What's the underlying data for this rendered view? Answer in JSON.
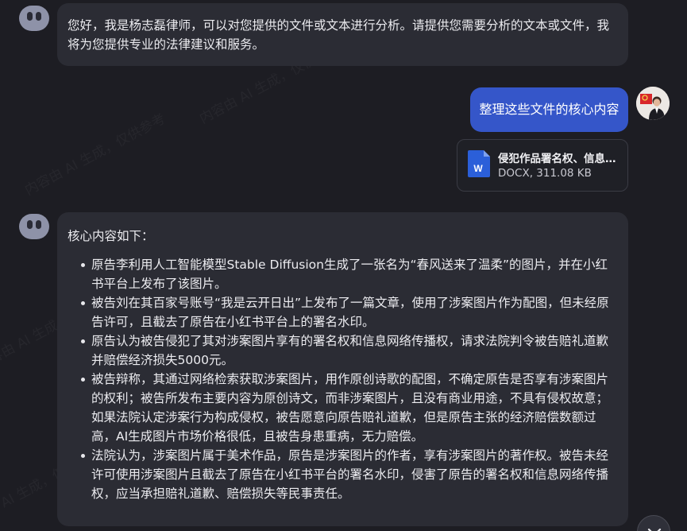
{
  "messages": {
    "greeting": "您好，我是杨志磊律师，可以对您提供的文件或文本进行分析。请提供您需要分析的文本或文件，我将为您提供专业的法律建议和服务。",
    "user_request": "整理这些文件的核心内容",
    "attachment": {
      "name": "侵犯作品署名权、信息…",
      "meta": "DOCX, 311.08 KB",
      "icon": "word-document-icon"
    },
    "answer": {
      "intro": "核心内容如下：",
      "points": [
        "原告李利用人工智能模型Stable Diffusion生成了一张名为“春风送来了温柔”的图片，并在小红书平台上发布了该图片。",
        "被告刘在其百家号账号“我是云开日出”上发布了一篇文章，使用了涉案图片作为配图，但未经原告许可，且截去了原告在小红书平台上的署名水印。",
        "原告认为被告侵犯了其对涉案图片享有的署名权和信息网络传播权，请求法院判令被告赔礼道歉并赔偿经济损失5000元。",
        "被告辩称，其通过网络检索获取涉案图片，用作原创诗歌的配图，不确定原告是否享有涉案图片的权利；被告所发布主要内容为原创诗文，而非涉案图片，且没有商业用途，不具有侵权故意；如果法院认定涉案行为构成侵权，被告愿意向原告赔礼道歉，但是原告主张的经济赔偿数额过高，AI生成图片市场价格很低，且被告身患重病，无力赔偿。",
        "法院认为，涉案图片属于美术作品，原告是涉案图片的作者，享有涉案图片的著作权。被告未经许可使用涉案图片且截去了原告在小红书平台的署名水印，侵害了原告的署名权和信息网络传播权，应当承担赔礼道歉、赔偿损失等民事责任。"
      ]
    }
  },
  "watermark_text": "内容由 AI 生成，仅供参考",
  "colors": {
    "background": "#1d1d23",
    "bot_bubble": "#2b2c34",
    "user_bubble": "#3556c9",
    "word_blue": "#2b5fd9"
  }
}
